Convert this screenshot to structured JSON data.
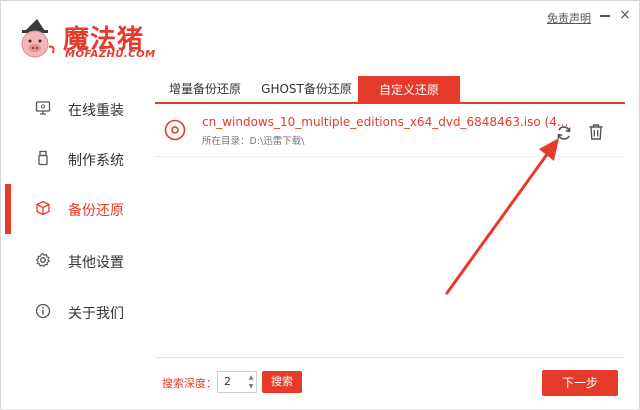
{
  "app": {
    "logo_title": "魔法猪",
    "logo_sub": "MOFAZHU.COM",
    "disclaimer": "免责声明",
    "close_glyph": "×"
  },
  "sidebar": {
    "items": [
      {
        "label": "在线重装",
        "icon": "monitor-icon",
        "active": false
      },
      {
        "label": "制作系统",
        "icon": "usb-icon",
        "active": false
      },
      {
        "label": "备份还原",
        "icon": "cube-icon",
        "active": true
      },
      {
        "label": "其他设置",
        "icon": "gear-icon",
        "active": false
      },
      {
        "label": "关于我们",
        "icon": "info-icon",
        "active": false
      }
    ]
  },
  "tabs": [
    {
      "label": "增量备份还原",
      "active": false
    },
    {
      "label": "GHOST备份还原",
      "active": false
    },
    {
      "label": "自定义还原",
      "active": true
    }
  ],
  "file": {
    "name": "cn_windows_10_multiple_editions_x64_dvd_6848463.iso (4...",
    "path": "所在目录：D:\\迅雷下载\\"
  },
  "footer": {
    "depth_label": "搜索深度：",
    "depth_value": "2",
    "spin_up": "▲",
    "spin_down": "▼",
    "search_label": "搜索",
    "next_label": "下一步"
  },
  "colors": {
    "accent": "#e63a2a",
    "text": "#333333",
    "muted": "#777777"
  }
}
